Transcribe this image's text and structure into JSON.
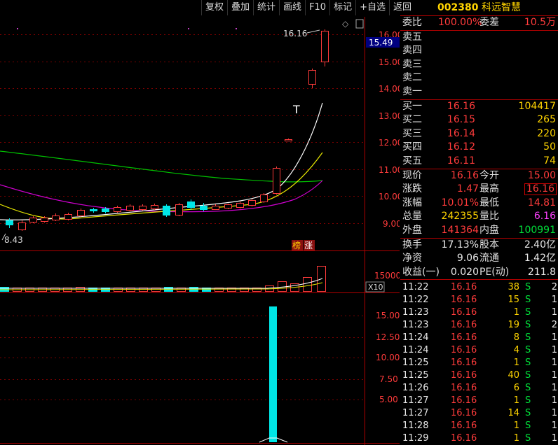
{
  "toolbar": [
    "复权",
    "叠加",
    "统计",
    "画线",
    "F10",
    "标记",
    "+自选",
    "返回"
  ],
  "chart": {
    "price_labels": [
      "16.00",
      "15.00",
      "14.00",
      "13.00",
      "12.00",
      "11.00",
      "10.00",
      "9.00"
    ],
    "current_price_label": "15.49",
    "high_label": "16.16",
    "low_label": "8.43",
    "tag_bang": "榜",
    "tag_zhang": "涨",
    "volume_label": "15000",
    "volume_unit": "X10",
    "indicator_labels": [
      "15.00",
      "12.50",
      "10.00",
      "7.50",
      "5.00"
    ],
    "t_marker": "T",
    "diamond": "◇"
  },
  "quote": {
    "code": "002380",
    "name": "科远智慧",
    "weibi_label": "委比",
    "weibi_value": "100.00%",
    "weicha_label": "委差",
    "weicha_value": "10.5万",
    "sell": [
      {
        "label": "卖五",
        "price": "",
        "vol": ""
      },
      {
        "label": "卖四",
        "price": "",
        "vol": ""
      },
      {
        "label": "卖三",
        "price": "",
        "vol": ""
      },
      {
        "label": "卖二",
        "price": "",
        "vol": ""
      },
      {
        "label": "卖一",
        "price": "",
        "vol": ""
      }
    ],
    "buy": [
      {
        "label": "买一",
        "price": "16.16",
        "vol": "104417"
      },
      {
        "label": "买二",
        "price": "16.15",
        "vol": "265"
      },
      {
        "label": "买三",
        "price": "16.14",
        "vol": "220"
      },
      {
        "label": "买四",
        "price": "16.12",
        "vol": "50"
      },
      {
        "label": "买五",
        "price": "16.11",
        "vol": "74"
      }
    ],
    "stats": [
      {
        "l1": "现价",
        "v1": "16.16",
        "l2": "今开",
        "v2": "15.00"
      },
      {
        "l1": "涨跌",
        "v1": "1.47",
        "l2": "最高",
        "v2": "16.16"
      },
      {
        "l1": "涨幅",
        "v1": "10.01%",
        "l2": "最低",
        "v2": "14.81"
      },
      {
        "l1": "总量",
        "v1": "242355",
        "l2": "量比",
        "v2": "6.16"
      },
      {
        "l1": "外盘",
        "v1": "141364",
        "l2": "内盘",
        "v2": "100991"
      }
    ],
    "fund": [
      {
        "l1": "换手",
        "v1": "17.13%",
        "l2": "股本",
        "v2": "2.40亿"
      },
      {
        "l1": "净资",
        "v1": "9.06",
        "l2": "流通",
        "v2": "1.42亿"
      },
      {
        "l1": "收益(一)",
        "v1": "0.020",
        "l2": "PE(动)",
        "v2": "211.8"
      }
    ],
    "ticks": [
      {
        "t": "11:22",
        "p": "16.16",
        "v": "38",
        "s": "S",
        "n": "2"
      },
      {
        "t": "11:22",
        "p": "16.16",
        "v": "15",
        "s": "S",
        "n": "1"
      },
      {
        "t": "11:23",
        "p": "16.16",
        "v": "1",
        "s": "S",
        "n": "1"
      },
      {
        "t": "11:23",
        "p": "16.16",
        "v": "19",
        "s": "S",
        "n": "2"
      },
      {
        "t": "11:24",
        "p": "16.16",
        "v": "8",
        "s": "S",
        "n": "1"
      },
      {
        "t": "11:24",
        "p": "16.16",
        "v": "4",
        "s": "S",
        "n": "1"
      },
      {
        "t": "11:25",
        "p": "16.16",
        "v": "1",
        "s": "S",
        "n": "1"
      },
      {
        "t": "11:25",
        "p": "16.16",
        "v": "40",
        "s": "S",
        "n": "1"
      },
      {
        "t": "11:26",
        "p": "16.16",
        "v": "6",
        "s": "S",
        "n": "1"
      },
      {
        "t": "11:27",
        "p": "16.16",
        "v": "1",
        "s": "S",
        "n": "1"
      },
      {
        "t": "11:27",
        "p": "16.16",
        "v": "14",
        "s": "S",
        "n": "1"
      },
      {
        "t": "11:28",
        "p": "16.16",
        "v": "1",
        "s": "S",
        "n": "1"
      },
      {
        "t": "11:29",
        "p": "16.16",
        "v": "1",
        "s": "S",
        "n": "1"
      }
    ]
  }
}
